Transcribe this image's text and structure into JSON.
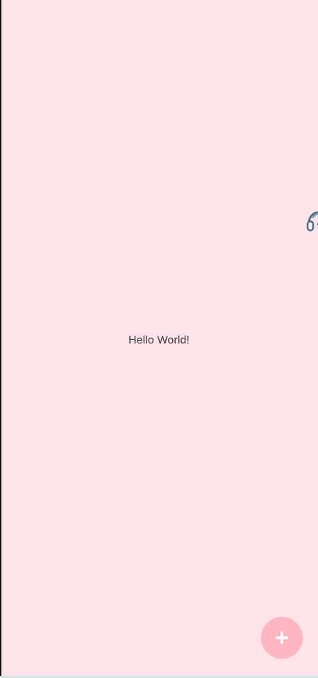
{
  "main": {
    "message": "Hello World!"
  },
  "colors": {
    "background": "#ffe3ea",
    "fab": "#ffb6c3",
    "text": "#3a3a3a"
  },
  "icons": {
    "floating_helper": "headset-icon",
    "fab": "plus-icon"
  }
}
